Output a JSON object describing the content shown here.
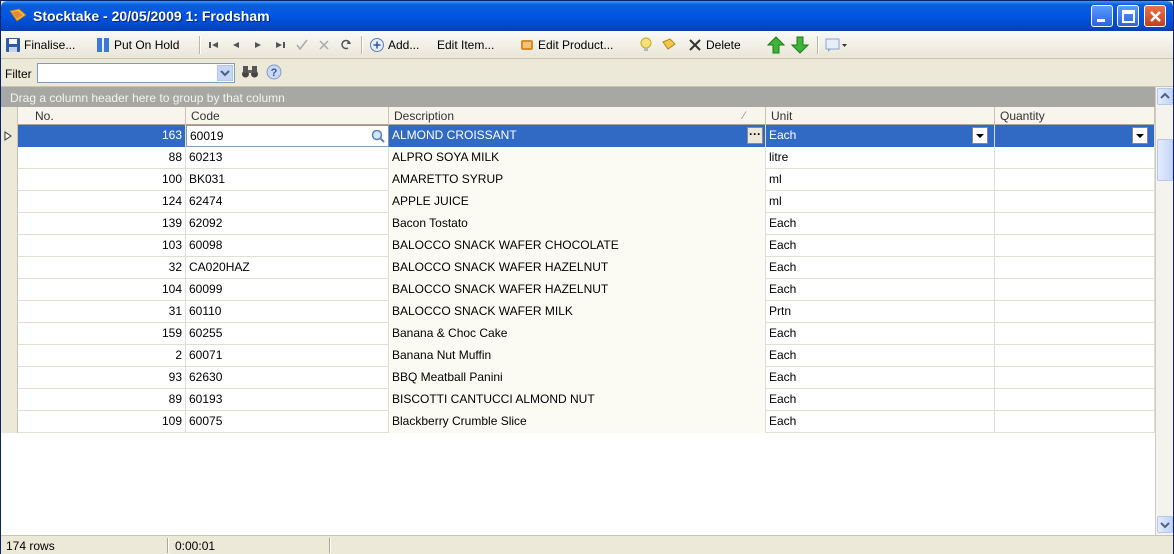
{
  "window": {
    "title": "Stocktake - 20/05/2009 1: Frodsham",
    "controls": [
      "minimize-icon",
      "maximize-icon",
      "close-icon"
    ]
  },
  "toolbar": {
    "finalise": "Finalise...",
    "put_on_hold": "Put On Hold",
    "add": "Add...",
    "edit_item": "Edit Item...",
    "edit_product": "Edit Product...",
    "delete": "Delete",
    "icons": [
      "save-icon",
      "pause-icon",
      "first-icon",
      "prev-icon",
      "next-icon",
      "last-icon",
      "confirm-icon",
      "cancel-icon",
      "refresh-icon",
      "add-icon",
      "edit-product-icon",
      "lightbulb-icon",
      "note-icon",
      "delete-icon",
      "move-up-icon",
      "move-down-icon",
      "view-options-icon"
    ]
  },
  "filter": {
    "label": "Filter",
    "value": "",
    "icons": [
      "dropdown-icon",
      "binoculars-icon",
      "help-icon"
    ]
  },
  "grid": {
    "group_hint": "Drag a column header here to group by that column",
    "columns": [
      "No.",
      "Code",
      "Description",
      "Unit",
      "Quantity"
    ],
    "sorted_column": "Description",
    "rows": [
      {
        "no": "163",
        "code": "60019",
        "description": "ALMOND CROISSANT",
        "unit": "Each",
        "quantity": ""
      },
      {
        "no": "88",
        "code": "60213",
        "description": "ALPRO SOYA MILK",
        "unit": "litre",
        "quantity": ""
      },
      {
        "no": "100",
        "code": "BK031",
        "description": "AMARETTO SYRUP",
        "unit": "ml",
        "quantity": ""
      },
      {
        "no": "124",
        "code": "62474",
        "description": "APPLE JUICE",
        "unit": "ml",
        "quantity": ""
      },
      {
        "no": "139",
        "code": "62092",
        "description": "Bacon Tostato",
        "unit": "Each",
        "quantity": ""
      },
      {
        "no": "103",
        "code": "60098",
        "description": "BALOCCO SNACK WAFER CHOCOLATE",
        "unit": "Each",
        "quantity": ""
      },
      {
        "no": "32",
        "code": "CA020HAZ",
        "description": "BALOCCO SNACK WAFER HAZELNUT",
        "unit": "Each",
        "quantity": ""
      },
      {
        "no": "104",
        "code": "60099",
        "description": "BALOCCO SNACK WAFER HAZELNUT",
        "unit": "Each",
        "quantity": ""
      },
      {
        "no": "31",
        "code": "60110",
        "description": "BALOCCO SNACK WAFER MILK",
        "unit": "Prtn",
        "quantity": ""
      },
      {
        "no": "159",
        "code": "60255",
        "description": "Banana & Choc Cake",
        "unit": "Each",
        "quantity": ""
      },
      {
        "no": "2",
        "code": "60071",
        "description": "Banana Nut Muffin",
        "unit": "Each",
        "quantity": ""
      },
      {
        "no": "93",
        "code": "62630",
        "description": "BBQ Meatball Panini",
        "unit": "Each",
        "quantity": ""
      },
      {
        "no": "89",
        "code": "60193",
        "description": "BISCOTTI CANTUCCI ALMOND NUT",
        "unit": "Each",
        "quantity": ""
      },
      {
        "no": "109",
        "code": "60075",
        "description": "Blackberry Crumble Slice",
        "unit": "Each",
        "quantity": ""
      }
    ]
  },
  "status": {
    "rows": "174 rows",
    "time": "0:00:01"
  },
  "colors": {
    "titlebar": "#0054e3",
    "selection": "#316ac5",
    "group_band": "#a7a7a3",
    "window_bg": "#ece9d8"
  }
}
